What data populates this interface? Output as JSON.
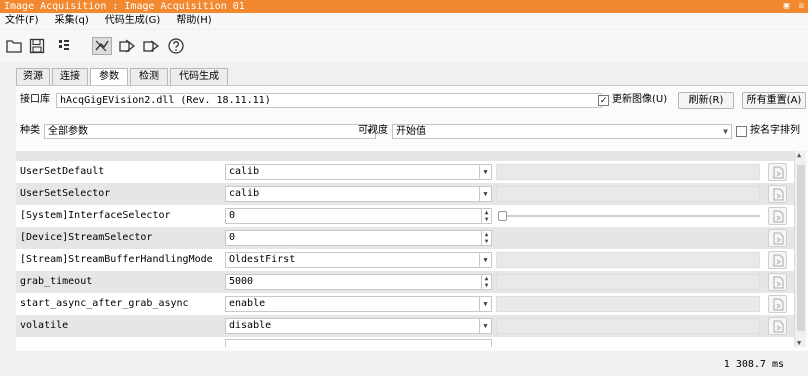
{
  "window": {
    "title": "Image Acquisition : Image Acquisition 01",
    "controls": "▣ ☒"
  },
  "menu": [
    {
      "label": "文件(F)"
    },
    {
      "label": "采集(q)"
    },
    {
      "label": "代码生成(G)"
    },
    {
      "label": "帮助(H)"
    }
  ],
  "toolbar": {
    "icons": [
      "folder-open-icon",
      "save-icon",
      "snap-icon",
      "live-icon",
      "connect-icon",
      "grab-icon",
      "help-icon"
    ]
  },
  "tabs": [
    {
      "label": "资源",
      "active": false
    },
    {
      "label": "连接",
      "active": false
    },
    {
      "label": "参数",
      "active": true
    },
    {
      "label": "检测",
      "active": false
    },
    {
      "label": "代码生成",
      "active": false
    }
  ],
  "interface": {
    "label": "接口库",
    "value": "hAcqGigEVision2.dll (Rev. 18.11.11)",
    "update_image_label": "更新图像(U)",
    "update_image_checked": true,
    "refresh_label": "刷新(R)",
    "reset_all_label": "所有重置(A)"
  },
  "filter": {
    "category_label": "种类",
    "category_value": "全部参数",
    "visibility_label": "可视度",
    "visibility_value": "开始值",
    "sort_label": "按名字排列",
    "sort_checked": false
  },
  "params": [
    {
      "name": "UserSetDefault",
      "value": "calib",
      "control": "dropdown",
      "extra": "box",
      "shade": false
    },
    {
      "name": "UserSetSelector",
      "value": "calib",
      "control": "dropdown",
      "extra": "box",
      "shade": true
    },
    {
      "name": "[System]InterfaceSelector",
      "value": "0",
      "control": "spin",
      "extra": "slider",
      "shade": false
    },
    {
      "name": "[Device]StreamSelector",
      "value": "0",
      "control": "spin",
      "extra": "none",
      "shade": true
    },
    {
      "name": "[Stream]StreamBufferHandlingMode",
      "value": "OldestFirst",
      "control": "dropdown",
      "extra": "box",
      "shade": false
    },
    {
      "name": "grab_timeout",
      "value": "5000",
      "control": "spin",
      "extra": "box",
      "shade": true
    },
    {
      "name": "start_async_after_grab_async",
      "value": "enable",
      "control": "dropdown",
      "extra": "box",
      "shade": false
    },
    {
      "name": "volatile",
      "value": "disable",
      "control": "dropdown",
      "extra": "box",
      "shade": true
    }
  ],
  "status": {
    "text": "1  308.7 ms"
  },
  "colors": {
    "titlebar": "#f2882f",
    "row_shade": "#e6e6e6"
  }
}
